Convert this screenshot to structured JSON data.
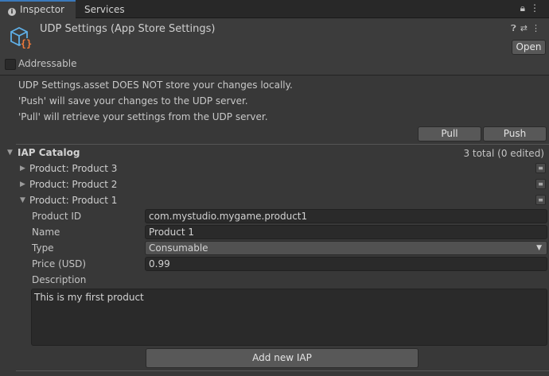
{
  "tabs": [
    {
      "label": "Inspector",
      "icon": "info-icon",
      "active": true
    },
    {
      "label": "Services",
      "active": false
    }
  ],
  "tab_icons": [
    "lock-icon",
    "more-icon"
  ],
  "header": {
    "title": "UDP Settings (App Store Settings)",
    "icon": "udp-settings-asset-icon",
    "icons": [
      "help-icon",
      "settings-sliders-icon",
      "more-icon"
    ],
    "open_label": "Open",
    "addressable_label": "Addressable",
    "addressable_checked": false
  },
  "info": {
    "line1": "UDP Settings.asset DOES NOT store your changes locally.",
    "line2": "'Push' will save your changes to the UDP server.",
    "line3": "'Pull' will retrieve your settings from the UDP server."
  },
  "actions": {
    "pull_label": "Pull",
    "push_label": "Push"
  },
  "catalog": {
    "title": "IAP Catalog",
    "count": "3 total (0 edited)",
    "products": [
      {
        "label": "Product: Product 3",
        "expanded": false
      },
      {
        "label": "Product: Product 2",
        "expanded": false
      },
      {
        "label": "Product: Product 1",
        "expanded": true
      }
    ],
    "expanded_product": {
      "product_id_label": "Product ID",
      "product_id": "com.mystudio.mygame.product1",
      "name_label": "Name",
      "name": "Product 1",
      "type_label": "Type",
      "type": "Consumable",
      "price_label": "Price (USD)",
      "price": "0.99",
      "description_label": "Description",
      "description": "This is my first product"
    },
    "add_label": "Add new IAP"
  },
  "colors": {
    "accent": "#3a79bb",
    "background": "#383838",
    "field": "#2a2a2a"
  }
}
